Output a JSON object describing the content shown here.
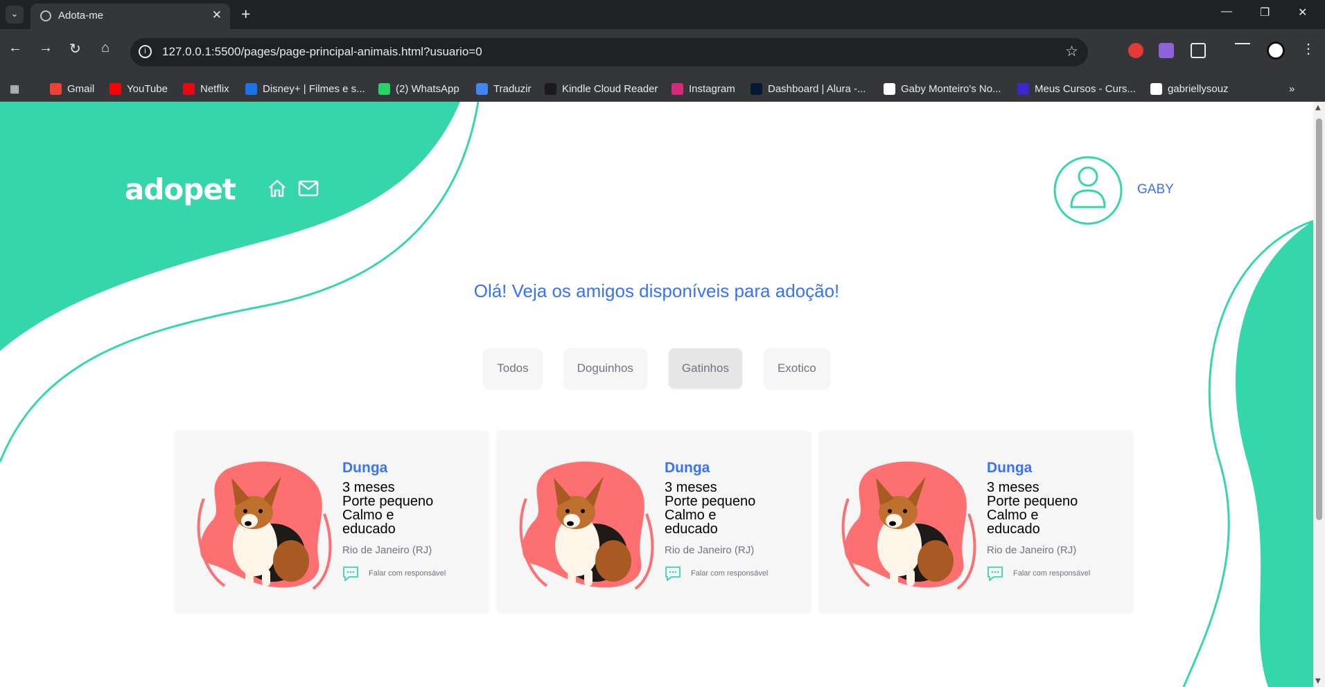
{
  "browser": {
    "tab_title": "Adota-me",
    "url": "127.0.0.1:5500/pages/page-principal-animais.html?usuario=0",
    "bookmarks": [
      {
        "label": "Gmail",
        "icon": "gmail-icon",
        "color": "#ea4335"
      },
      {
        "label": "YouTube",
        "icon": "youtube-icon",
        "color": "#ff0000"
      },
      {
        "label": "Netflix",
        "icon": "netflix-icon",
        "color": "#e50914"
      },
      {
        "label": "Disney+ | Filmes e s...",
        "icon": "disney-icon",
        "color": "#1a73e8"
      },
      {
        "label": "(2) WhatsApp",
        "icon": "whatsapp-icon",
        "color": "#25d366"
      },
      {
        "label": "Traduzir",
        "icon": "translate-icon",
        "color": "#4285f4"
      },
      {
        "label": "Kindle Cloud Reader",
        "icon": "kindle-icon",
        "color": "#1a1a1a"
      },
      {
        "label": "Instagram",
        "icon": "instagram-icon",
        "color": "#d62976"
      },
      {
        "label": "Dashboard | Alura -...",
        "icon": "alura-icon",
        "color": "#051933"
      },
      {
        "label": "Gaby Monteiro's No...",
        "icon": "notion-icon",
        "color": "#ffffff"
      },
      {
        "label": "Meus Cursos - Curs...",
        "icon": "courses-icon",
        "color": "#3b28cc"
      },
      {
        "label": "gabriellysouz",
        "icon": "github-icon",
        "color": "#ffffff"
      }
    ]
  },
  "header": {
    "logo": "adopet",
    "user_name": "GABY"
  },
  "main": {
    "greeting": "Olá! Veja os amigos disponíveis para adoção!",
    "filters": [
      {
        "label": "Todos",
        "active": false
      },
      {
        "label": "Doguinhos",
        "active": false
      },
      {
        "label": "Gatinhos",
        "active": true
      },
      {
        "label": "Exotico",
        "active": false
      }
    ],
    "pets": [
      {
        "name": "Dunga",
        "age": "3 meses",
        "size": "Porte pequeno",
        "temper_1": "Calmo e",
        "temper_2": "educado",
        "location": "Rio de Janeiro (RJ)",
        "contact": "Falar com responsável"
      },
      {
        "name": "Dunga",
        "age": "3 meses",
        "size": "Porte pequeno",
        "temper_1": "Calmo e",
        "temper_2": "educado",
        "location": "Rio de Janeiro (RJ)",
        "contact": "Falar com responsável"
      },
      {
        "name": "Dunga",
        "age": "3 meses",
        "size": "Porte pequeno",
        "temper_1": "Calmo e",
        "temper_2": "educado",
        "location": "Rio de Janeiro (RJ)",
        "contact": "Falar com responsável"
      }
    ]
  },
  "colors": {
    "accent_green": "#36d6ad",
    "accent_blue": "#3772ff",
    "blob_red": "#fc7071"
  }
}
